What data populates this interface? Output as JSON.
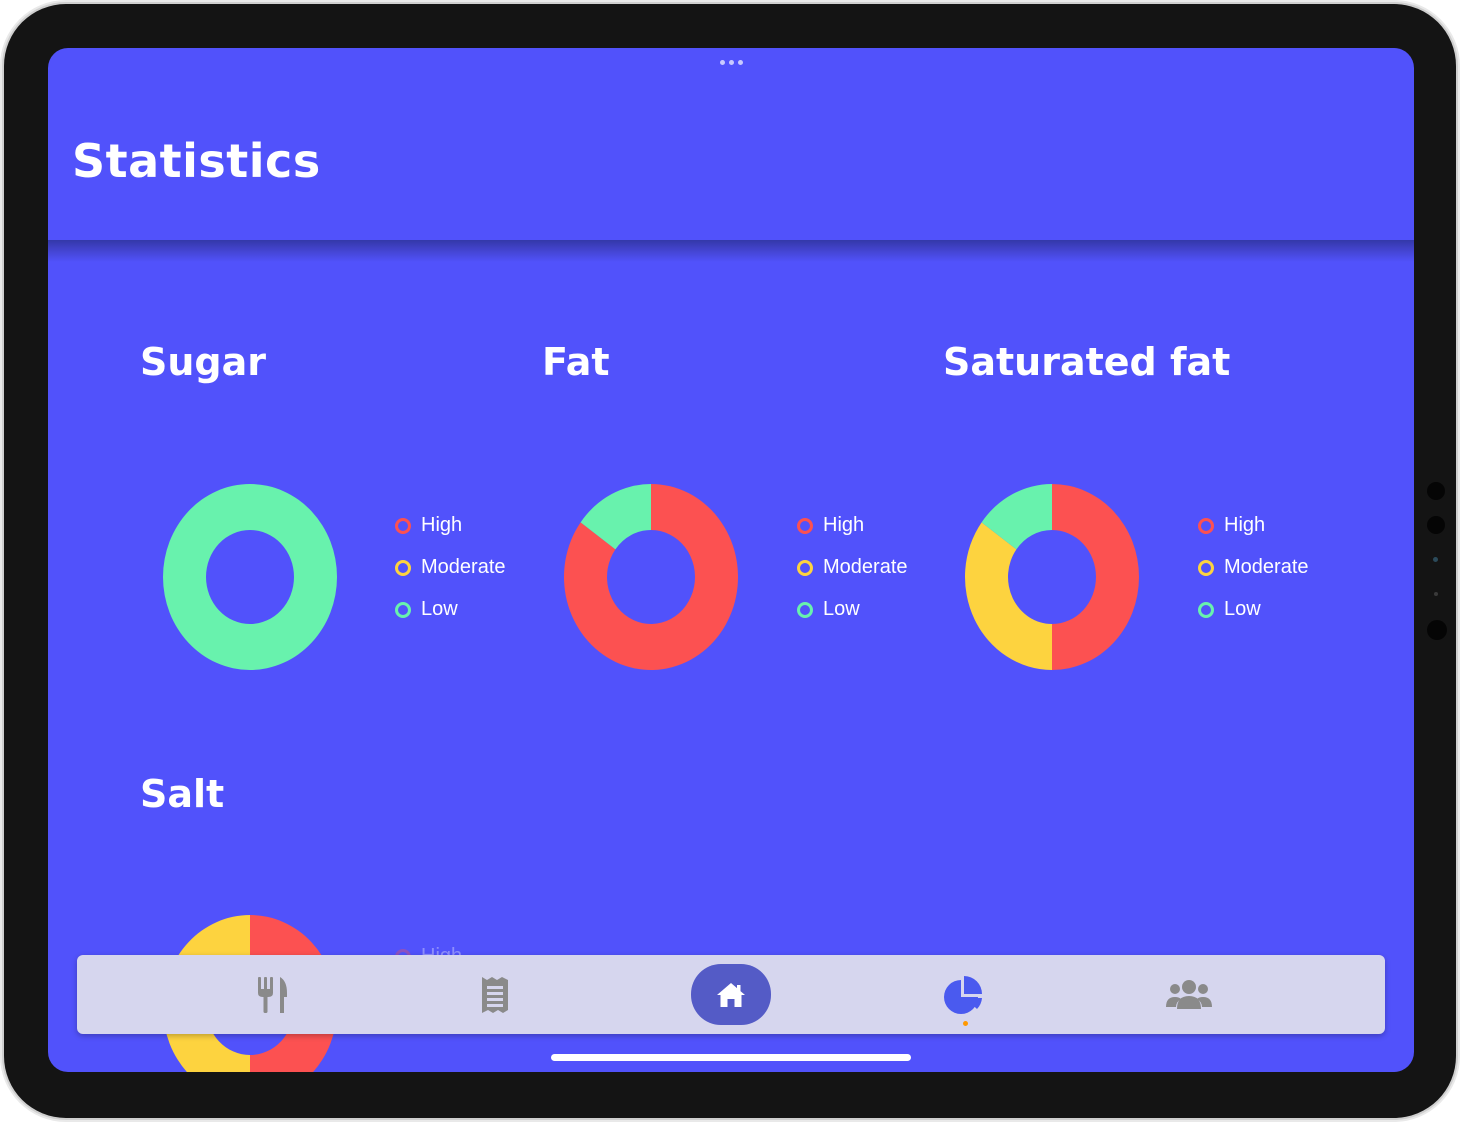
{
  "header": {
    "title": "Statistics"
  },
  "colors": {
    "background": "#5152fb",
    "high": "#fc5151",
    "moderate": "#fdd33f",
    "low": "#68f2ad",
    "tabbar": "#d6d6ee",
    "tab_icon": "#8a8a8a",
    "tab_active": "#4a5aef",
    "active_indicator": "#ff9800"
  },
  "legend": {
    "high": "High",
    "moderate": "Moderate",
    "low": "Low"
  },
  "chart_data": [
    {
      "type": "pie",
      "title": "Sugar",
      "categories": [
        "High",
        "Moderate",
        "Low"
      ],
      "values": [
        0,
        0,
        100
      ]
    },
    {
      "type": "pie",
      "title": "Fat",
      "categories": [
        "High",
        "Moderate",
        "Low"
      ],
      "values": [
        85,
        0,
        15
      ]
    },
    {
      "type": "pie",
      "title": "Saturated fat",
      "categories": [
        "High",
        "Moderate",
        "Low"
      ],
      "values": [
        50,
        35,
        15
      ]
    },
    {
      "type": "pie",
      "title": "Salt",
      "categories": [
        "High",
        "Moderate",
        "Low"
      ],
      "values": [
        50,
        50,
        0
      ],
      "partially_visible": true,
      "legend_visible": [
        "High"
      ]
    }
  ],
  "tabbar": {
    "tabs": [
      {
        "icon": "cutlery-icon",
        "active": false
      },
      {
        "icon": "receipt-icon",
        "active": false
      },
      {
        "icon": "home-icon",
        "active": false,
        "highlighted": true
      },
      {
        "icon": "pie-chart-icon",
        "active": true
      },
      {
        "icon": "users-icon",
        "active": false
      }
    ]
  }
}
